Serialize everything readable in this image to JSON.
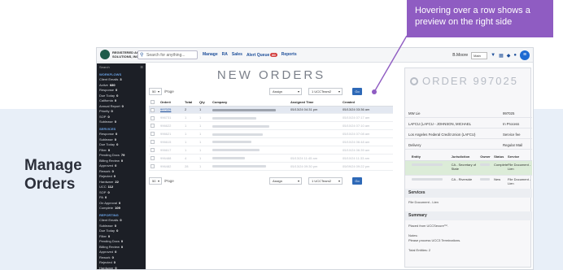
{
  "side_label": [
    "Manage",
    "Orders"
  ],
  "callout": {
    "text": "Hovering over a row shows a preview on the right side"
  },
  "topbar": {
    "logo_text": [
      "REGISTERED AGENT",
      "SOLUTIONS, INC."
    ],
    "search_placeholder": "Search for anything...",
    "nav": [
      "Manage",
      "RA",
      "Sales",
      "Alert Queue",
      "Reports"
    ],
    "alert_count": "80",
    "user_name": "B.Moore",
    "user_select": "Main"
  },
  "sidebar": {
    "search_label": "Search",
    "sections": [
      {
        "title": "WORKFLOWS",
        "items": [
          {
            "label": "Client Emails",
            "count": "3"
          },
          {
            "label": "Active",
            "count": "680"
          },
          {
            "label": "Response",
            "count": "0"
          },
          {
            "label": "Due Today",
            "count": "0"
          },
          {
            "label": "California",
            "count": "0"
          },
          {
            "label": "Annual Report",
            "count": "0"
          },
          {
            "label": "Priority",
            "count": "0"
          },
          {
            "label": "SOP",
            "count": "0"
          },
          {
            "label": "Sublease",
            "count": "0"
          }
        ]
      },
      {
        "title": "SERVICES",
        "items": [
          {
            "label": "Response",
            "count": "0"
          },
          {
            "label": "Sublease",
            "count": "0"
          },
          {
            "label": "Due Today",
            "count": "0"
          },
          {
            "label": "Filter",
            "count": "0"
          },
          {
            "label": "Pending Docs",
            "count": "79"
          },
          {
            "label": "Billing Review",
            "count": "0"
          },
          {
            "label": "Approved",
            "count": "0"
          },
          {
            "label": "Rework",
            "count": "0"
          },
          {
            "label": "Rejected",
            "count": "0"
          },
          {
            "label": "Hardware",
            "count": "22"
          },
          {
            "label": "UCC",
            "count": "112"
          },
          {
            "label": "SOP",
            "count": "0"
          },
          {
            "label": "PA",
            "count": "0"
          },
          {
            "label": "On Approval",
            "count": "0"
          },
          {
            "label": "Complete",
            "count": "109"
          }
        ]
      },
      {
        "title": "REPORTING",
        "items": [
          {
            "label": "Client Emails",
            "count": "0"
          },
          {
            "label": "Sublease",
            "count": "0"
          },
          {
            "label": "Due Today",
            "count": "0"
          },
          {
            "label": "Filter",
            "count": "0"
          },
          {
            "label": "Pending Docs",
            "count": "0"
          },
          {
            "label": "Billing Review",
            "count": "0"
          },
          {
            "label": "Approved",
            "count": "0"
          },
          {
            "label": "Rework",
            "count": "0"
          },
          {
            "label": "Rejected",
            "count": "0"
          },
          {
            "label": "Hardware",
            "count": "0"
          },
          {
            "label": "Response",
            "count": "0"
          },
          {
            "label": "ETA",
            "count": "0"
          }
        ]
      }
    ]
  },
  "main": {
    "title": "NEW ORDERS",
    "per_page_value": "50",
    "per_page_label": "/Page",
    "assign_label": "Assign",
    "team_value": "1 UCCTeam2",
    "go_label": "Go",
    "columns": [
      "Order#",
      "Total",
      "Qty",
      "Company",
      "Assigned Time",
      "Created"
    ],
    "rows": [
      {
        "order": "997025",
        "total": "2",
        "qty": "1",
        "assigned": "05/13/24 04:31 pm",
        "created": "05/13/24 03:36 am",
        "hovered": true
      },
      {
        "order": "996731",
        "total": "1",
        "qty": "1",
        "assigned": "",
        "created": "05/10/24 07:17 am",
        "hovered": false
      },
      {
        "order": "996622",
        "total": "1",
        "qty": "1",
        "assigned": "",
        "created": "05/10/24 07:10 am",
        "hovered": false
      },
      {
        "order": "996621",
        "total": "1",
        "qty": "1",
        "assigned": "",
        "created": "05/10/24 07:08 am",
        "hovered": false
      },
      {
        "order": "996615",
        "total": "1",
        "qty": "1",
        "assigned": "",
        "created": "05/10/24 06:48 am",
        "hovered": false
      },
      {
        "order": "996617",
        "total": "1",
        "qty": "1",
        "assigned": "",
        "created": "05/10/24 06:39 am",
        "hovered": false
      },
      {
        "order": "996488",
        "total": "4",
        "qty": "1",
        "assigned": "05/13/24 11:45 am",
        "created": "05/10/24 11:33 am",
        "hovered": false
      },
      {
        "order": "996482",
        "total": "28",
        "qty": "1",
        "assigned": "05/13/24 09:30 pm",
        "created": "05/09/24 09:22 pm",
        "hovered": false
      }
    ]
  },
  "preview": {
    "title": "ORDER 997025",
    "select_value": "Main",
    "info_rows": [
      {
        "left": "MW Lie",
        "right": "997025"
      },
      {
        "left": "LAFCU (LAFCU - JOHNSON, MICHAEL",
        "right": "In Process"
      },
      {
        "left": "Los Angeles Federal Credit Union (LAFCU)",
        "right": "Service fee"
      },
      {
        "left": "Delivery",
        "right": "Regular Mail"
      }
    ],
    "table_head": [
      "Entity",
      "Jurisdiction",
      "Owner",
      "Status",
      "Service"
    ],
    "table_rows": [
      {
        "jurisdiction": "CA - Secretary of State",
        "status": "Complete",
        "service": "File Document - Lien",
        "green": true
      },
      {
        "jurisdiction": "CA - Riverside",
        "status": "New",
        "service": "File Document - Lien",
        "green": false
      }
    ],
    "services_title": "Services",
    "services_item": "File Document - Lien",
    "summary_title": "Summary",
    "summary_lines": [
      "Placed from UCCSecure™.",
      "Notes:",
      "Please process UCC3 Terminations.",
      "Total Entities: 2"
    ]
  }
}
